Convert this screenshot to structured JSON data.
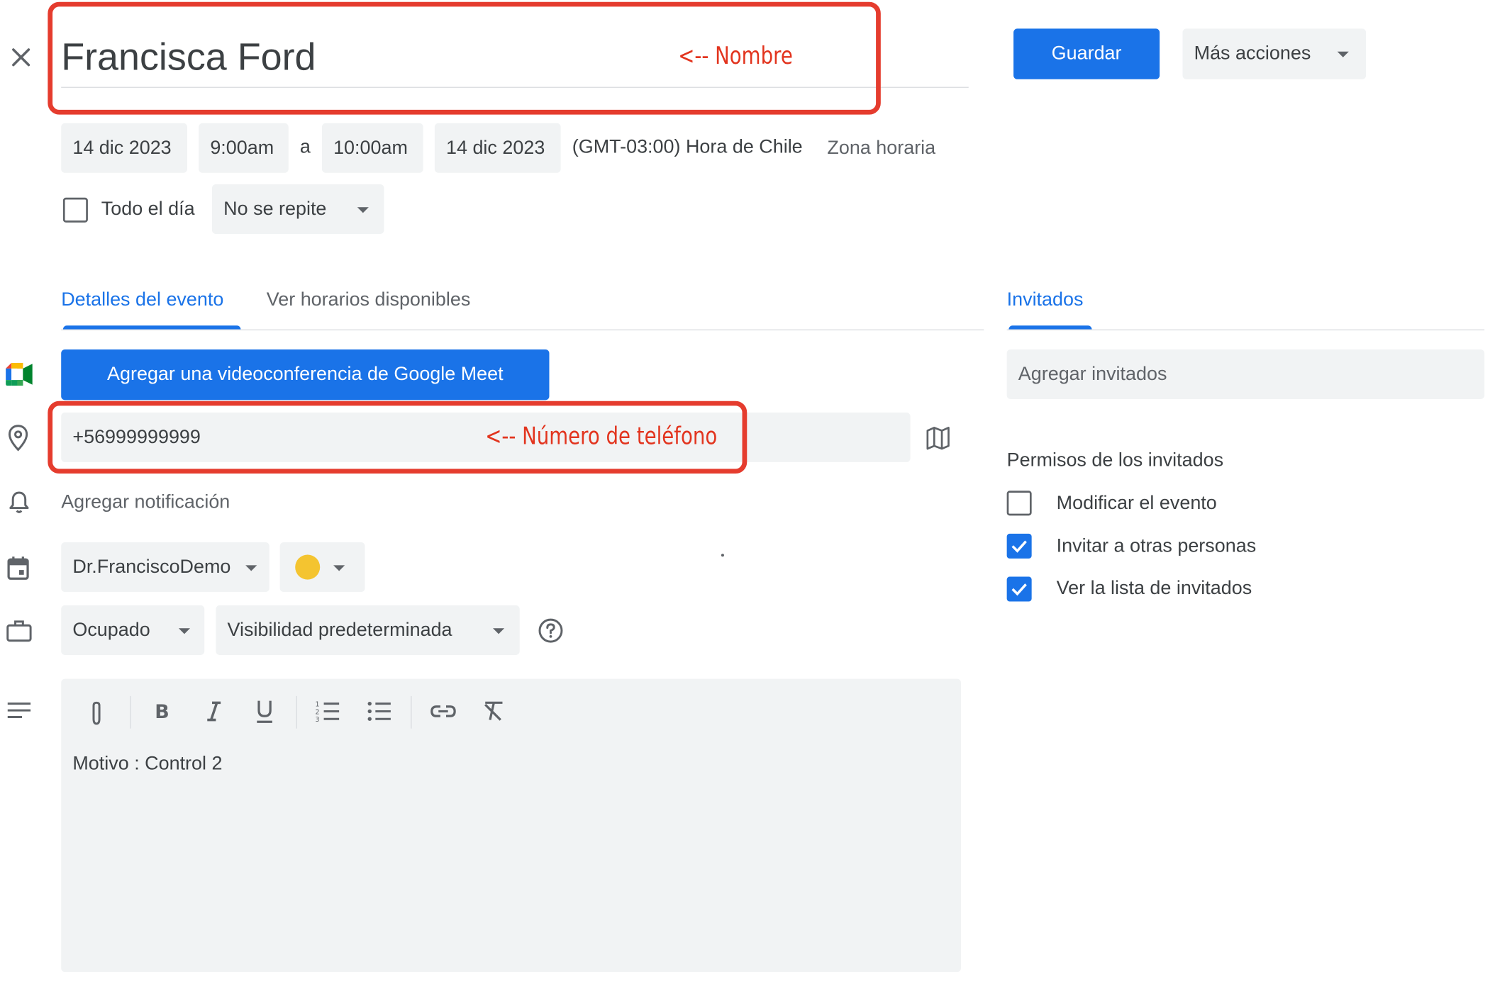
{
  "event": {
    "title": "Francisca Ford",
    "start_date": "14 dic 2023",
    "start_time": "9:00am",
    "to_label": "a",
    "end_time": "10:00am",
    "end_date": "14 dic 2023",
    "timezone": "(GMT-03:00) Hora de Chile",
    "timezone_link": "Zona horaria",
    "all_day_label": "Todo el día",
    "repeat_value": "No se repite"
  },
  "header": {
    "save_label": "Guardar",
    "more_actions_label": "Más acciones"
  },
  "tabs": {
    "details": "Detalles del evento",
    "availability": "Ver horarios disponibles",
    "guests": "Invitados"
  },
  "details": {
    "meet_button": "Agregar una videoconferencia de Google Meet",
    "location_value": "+56999999999",
    "add_notification": "Agregar notificación",
    "calendar_value": "Dr.FranciscoDemo",
    "event_color": "#f4c430",
    "status_value": "Ocupado",
    "visibility_value": "Visibilidad predeterminada",
    "description": "Motivo : Control 2"
  },
  "guests": {
    "add_placeholder": "Agregar invitados",
    "permissions_title": "Permisos de los invitados",
    "permissions": [
      {
        "label": "Modificar el evento",
        "checked": false
      },
      {
        "label": "Invitar a otras personas",
        "checked": true
      },
      {
        "label": "Ver la lista de invitados",
        "checked": true
      }
    ]
  },
  "annotations": {
    "name_note": "<-- Nombre",
    "phone_note": "<-- Número de teléfono"
  },
  "colors": {
    "accent": "#1a73e8",
    "annotation": "#e53c2e",
    "field_bg": "#f1f3f4"
  },
  "icons": [
    "close-icon",
    "google-meet-icon",
    "location-pin-icon",
    "bell-icon",
    "calendar-icon",
    "briefcase-icon",
    "description-lines-icon",
    "map-icon",
    "help-icon",
    "attach-icon",
    "bold-icon",
    "italic-icon",
    "underline-icon",
    "numbered-list-icon",
    "bulleted-list-icon",
    "link-icon",
    "clear-format-icon"
  ]
}
